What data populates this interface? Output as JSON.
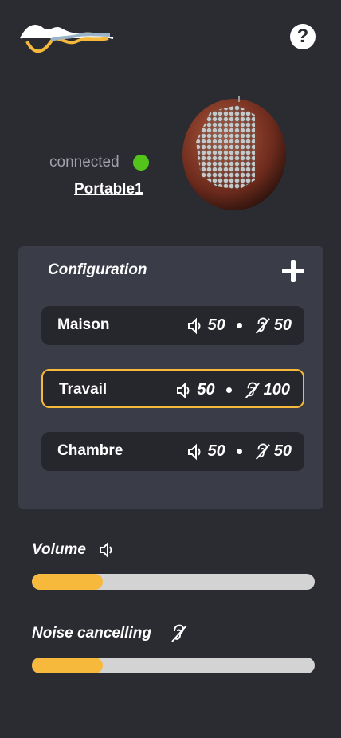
{
  "header": {
    "help_label": "?",
    "logo_icon": "wave-logo-icon"
  },
  "device": {
    "status": "connected",
    "status_color": "#52c41a",
    "name": "Portable1",
    "image_icon": "earbud-image"
  },
  "configuration": {
    "title": "Configuration",
    "profiles": [
      {
        "name": "Maison",
        "volume": "50",
        "noise": "50",
        "active": false
      },
      {
        "name": "Travail",
        "volume": "50",
        "noise": "100",
        "active": true
      },
      {
        "name": "Chambre",
        "volume": "50",
        "noise": "50",
        "active": false
      }
    ]
  },
  "volume": {
    "label": "Volume",
    "level": 0.25
  },
  "noise": {
    "label": "Noise cancelling",
    "level": 0.25
  },
  "colors": {
    "accent": "#f6b93b",
    "background": "#2b2b32",
    "card": "#3a3c48"
  }
}
